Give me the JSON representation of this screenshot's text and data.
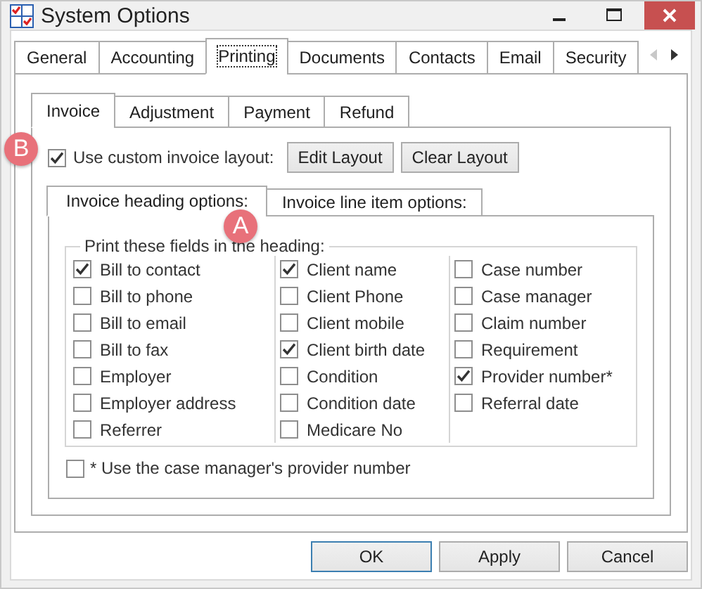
{
  "window": {
    "title": "System Options"
  },
  "tabs": [
    {
      "label": "General",
      "selected": false
    },
    {
      "label": "Accounting",
      "selected": false
    },
    {
      "label": "Printing",
      "selected": true
    },
    {
      "label": "Documents",
      "selected": false
    },
    {
      "label": "Contacts",
      "selected": false
    },
    {
      "label": "Email",
      "selected": false
    },
    {
      "label": "Security",
      "selected": false
    }
  ],
  "sub_tabs": [
    {
      "label": "Invoice",
      "selected": true
    },
    {
      "label": "Adjustment",
      "selected": false
    },
    {
      "label": "Payment",
      "selected": false
    },
    {
      "label": "Refund",
      "selected": false
    }
  ],
  "custom_layout": {
    "label": "Use custom invoice layout:",
    "checked": true
  },
  "layout_buttons": [
    "Edit Layout",
    "Clear Layout"
  ],
  "option_tabs": [
    {
      "label": "Invoice heading options:",
      "selected": true
    },
    {
      "label": "Invoice line item options:",
      "selected": false
    }
  ],
  "heading_group": {
    "title": "Print these fields in the heading:",
    "columns": [
      [
        {
          "label": "Bill to contact",
          "checked": true
        },
        {
          "label": "Bill to phone",
          "checked": false
        },
        {
          "label": "Bill to email",
          "checked": false
        },
        {
          "label": "Bill to fax",
          "checked": false
        },
        {
          "label": "Employer",
          "checked": false
        },
        {
          "label": "Employer address",
          "checked": false
        },
        {
          "label": "Referrer",
          "checked": false
        }
      ],
      [
        {
          "label": "Client name",
          "checked": true
        },
        {
          "label": "Client Phone",
          "checked": false
        },
        {
          "label": "Client mobile",
          "checked": false
        },
        {
          "label": "Client birth date",
          "checked": true
        },
        {
          "label": "Condition",
          "checked": false
        },
        {
          "label": "Condition date",
          "checked": false
        },
        {
          "label": "Medicare No",
          "checked": false
        }
      ],
      [
        {
          "label": "Case number",
          "checked": false
        },
        {
          "label": "Case manager",
          "checked": false
        },
        {
          "label": "Claim number",
          "checked": false
        },
        {
          "label": "Requirement",
          "checked": false
        },
        {
          "label": "Provider number*",
          "checked": true
        },
        {
          "label": "Referral date",
          "checked": false
        }
      ]
    ]
  },
  "case_manager_option": {
    "label": "* Use the case manager's provider number",
    "checked": false
  },
  "callouts": [
    {
      "label": "B"
    },
    {
      "label": "A"
    }
  ],
  "buttons": [
    {
      "label": "OK",
      "selected": true
    },
    {
      "label": "Apply",
      "selected": false
    },
    {
      "label": "Cancel",
      "selected": false
    }
  ]
}
